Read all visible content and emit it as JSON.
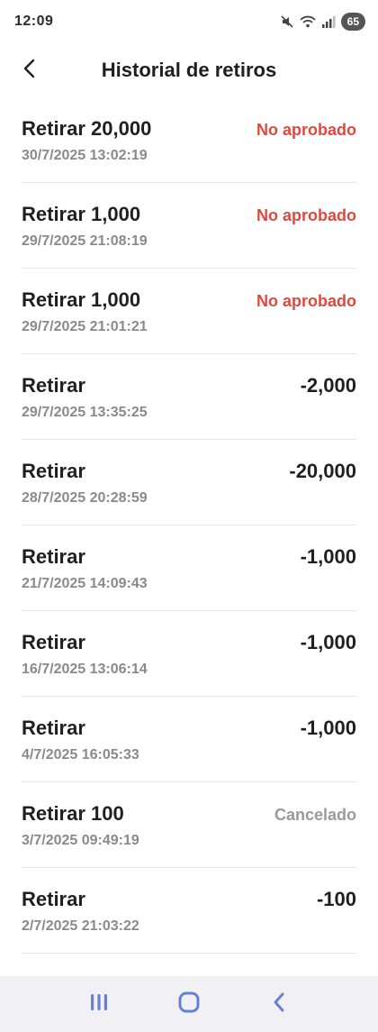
{
  "status_bar": {
    "time": "12:09",
    "battery": "65",
    "icons": [
      "mute-icon",
      "wifi-icon",
      "signal-icon",
      "battery-icon"
    ]
  },
  "header": {
    "title": "Historial de retiros",
    "back_icon": "back-arrow-icon"
  },
  "colors": {
    "rejected": "#e0473f",
    "cancelled": "#9a9a9a",
    "text": "#1f1f1f",
    "secondary": "#8a8a8a"
  },
  "withdrawals": [
    {
      "label": "Retirar 20,000",
      "date": "30/7/2025 13:02:19",
      "value": "No aprobado",
      "status": "rejected"
    },
    {
      "label": "Retirar 1,000",
      "date": "29/7/2025 21:08:19",
      "value": "No aprobado",
      "status": "rejected"
    },
    {
      "label": "Retirar 1,000",
      "date": "29/7/2025 21:01:21",
      "value": "No aprobado",
      "status": "rejected"
    },
    {
      "label": "Retirar",
      "date": "29/7/2025 13:35:25",
      "value": "-2,000",
      "status": "completed"
    },
    {
      "label": "Retirar",
      "date": "28/7/2025 20:28:59",
      "value": "-20,000",
      "status": "completed"
    },
    {
      "label": "Retirar",
      "date": "21/7/2025 14:09:43",
      "value": "-1,000",
      "status": "completed"
    },
    {
      "label": "Retirar",
      "date": "16/7/2025 13:06:14",
      "value": "-1,000",
      "status": "completed"
    },
    {
      "label": "Retirar",
      "date": "4/7/2025 16:05:33",
      "value": "-1,000",
      "status": "completed"
    },
    {
      "label": "Retirar 100",
      "date": "3/7/2025 09:49:19",
      "value": "Cancelado",
      "status": "cancelled"
    },
    {
      "label": "Retirar",
      "date": "2/7/2025 21:03:22",
      "value": "-100",
      "status": "completed"
    }
  ],
  "nav_bar": {
    "buttons": [
      "recents-icon",
      "home-icon",
      "back-icon"
    ]
  }
}
